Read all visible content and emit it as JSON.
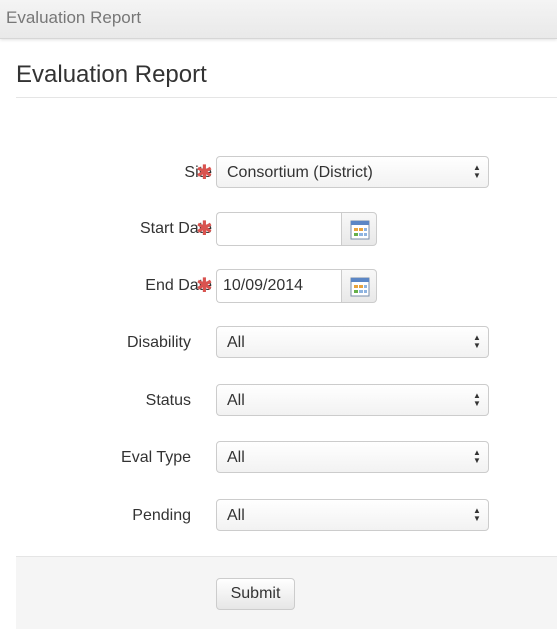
{
  "window": {
    "title": "Evaluation Report"
  },
  "page": {
    "title": "Evaluation Report"
  },
  "form": {
    "site": {
      "label": "Site",
      "value": "Consortium (District)"
    },
    "start_date": {
      "label": "Start Date",
      "value": ""
    },
    "end_date": {
      "label": "End Date",
      "value": "10/09/2014"
    },
    "disability": {
      "label": "Disability",
      "value": "All"
    },
    "status": {
      "label": "Status",
      "value": "All"
    },
    "eval_type": {
      "label": "Eval Type",
      "value": "All"
    },
    "pending": {
      "label": "Pending",
      "value": "All"
    },
    "required_marker": "✱",
    "calendar_icon": "calendar-icon",
    "submit_label": "Submit"
  },
  "colors": {
    "required": "#d9534f",
    "footer_bg": "#f5f5f5"
  }
}
